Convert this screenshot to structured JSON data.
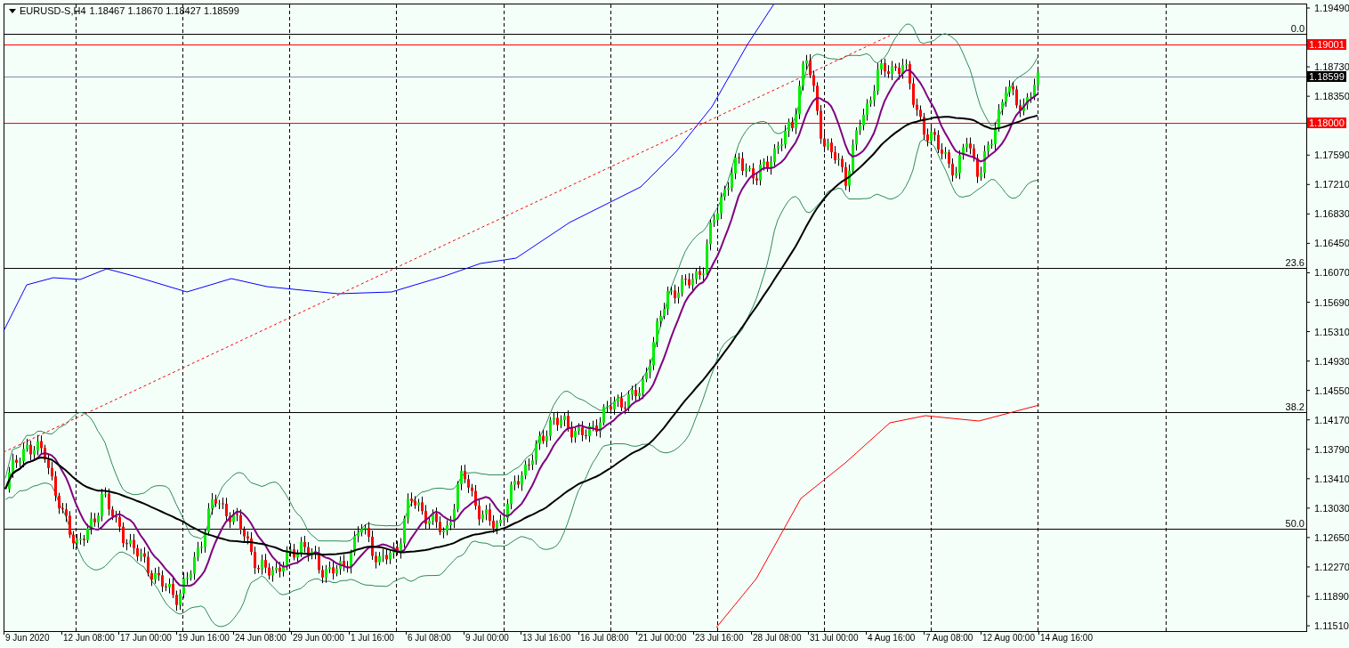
{
  "symbol_bar": {
    "symbol": "EURUSD-S,H4",
    "ohlc": "1.18467 1.18670 1.18427 1.18599"
  },
  "price_axis": {
    "ticks": [
      "1.19490",
      "1.18730",
      "1.18350",
      "1.17590",
      "1.17210",
      "1.16830",
      "1.16450",
      "1.16070",
      "1.15690",
      "1.15310",
      "1.14930",
      "1.14550",
      "1.14170",
      "1.13790",
      "1.13410",
      "1.13030",
      "1.12650",
      "1.12270",
      "1.11890",
      "1.11510"
    ]
  },
  "price_tags": [
    {
      "text": "1.19001",
      "kind": "alert"
    },
    {
      "text": "1.18599",
      "kind": "bid"
    },
    {
      "text": "1.18000",
      "kind": "alert"
    }
  ],
  "fibo_levels": [
    {
      "label": "0.0"
    },
    {
      "label": "23.6"
    },
    {
      "label": "38.2"
    },
    {
      "label": "50.0"
    }
  ],
  "time_axis": {
    "ticks": [
      "9 Jun 2020",
      "12 Jun 08:00",
      "17 Jun 00:00",
      "19 Jun 16:00",
      "24 Jun 08:00",
      "29 Jun 00:00",
      "1 Jul 16:00",
      "6 Jul 08:00",
      "9 Jul 00:00",
      "13 Jul 16:00",
      "16 Jul 08:00",
      "21 Jul 00:00",
      "23 Jul 16:00",
      "28 Jul 08:00",
      "31 Jul 00:00",
      "4 Aug 16:00",
      "7 Aug 08:00",
      "12 Aug 00:00",
      "14 Aug 16:00"
    ]
  }
}
